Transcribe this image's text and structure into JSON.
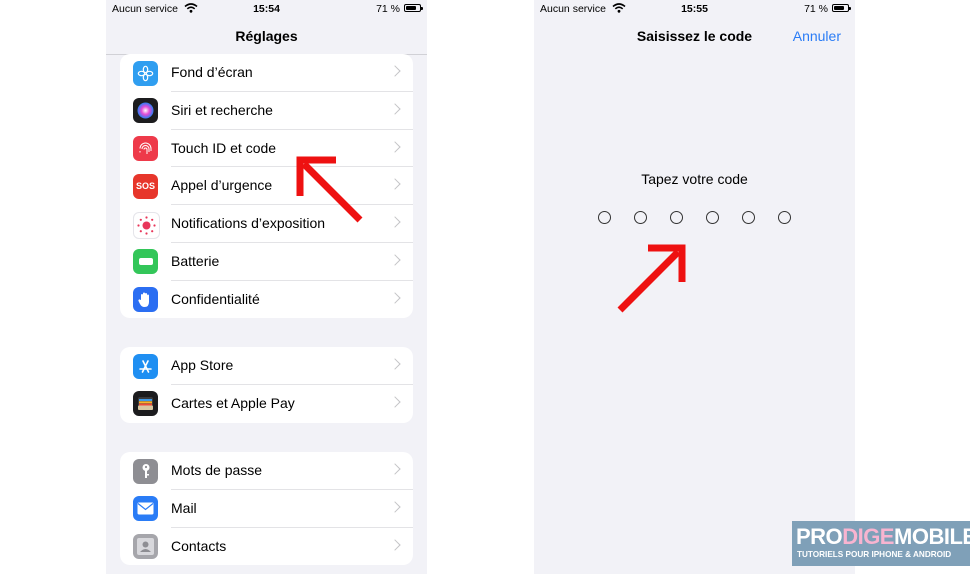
{
  "left_screen": {
    "status": {
      "carrier": "Aucun service",
      "time": "15:54",
      "battery": "71 %"
    },
    "title": "Réglages",
    "groups": [
      [
        {
          "label": "Fond d’écran",
          "icon": "flower-icon",
          "color": "#2f9ef0"
        },
        {
          "label": "Siri et recherche",
          "icon": "siri-icon",
          "color": "#1c1c1e"
        },
        {
          "label": "Touch ID et code",
          "icon": "fingerprint-icon",
          "color": "#ee3a4a"
        },
        {
          "label": "Appel d’urgence",
          "icon": "sos-icon",
          "color": "#e7362b"
        },
        {
          "label": "Notifications d’exposition",
          "icon": "exposure-icon",
          "color": "#ffffff"
        },
        {
          "label": "Batterie",
          "icon": "battery-icon",
          "color": "#33c659"
        },
        {
          "label": "Confidentialité",
          "icon": "hand-icon",
          "color": "#2b6ef2"
        }
      ],
      [
        {
          "label": "App Store",
          "icon": "app-store-icon",
          "color": "#1f8ff2"
        },
        {
          "label": "Cartes et Apple Pay",
          "icon": "wallet-icon",
          "color": "#1c1c1e"
        }
      ],
      [
        {
          "label": "Mots de passe",
          "icon": "key-icon",
          "color": "#8e8e93"
        },
        {
          "label": "Mail",
          "icon": "mail-icon",
          "color": "#2a7cf6"
        },
        {
          "label": "Contacts",
          "icon": "contacts-icon",
          "color": "#a6a6ab"
        }
      ]
    ]
  },
  "right_screen": {
    "status": {
      "carrier": "Aucun service",
      "time": "15:55",
      "battery": "71 %"
    },
    "title": "Saisissez le code",
    "cancel": "Annuler",
    "prompt": "Tapez votre code",
    "code_length": 6
  },
  "logo": {
    "brand_a": "PRO",
    "brand_b": "DIGE",
    "brand_c": "M",
    "brand_d": "O",
    "brand_e": "BILE",
    "tagline": "TUTORIELS POUR IPHONE & ANDROID"
  },
  "colors": {
    "accent": "#2a7cf6",
    "arrow": "#ee1111"
  }
}
